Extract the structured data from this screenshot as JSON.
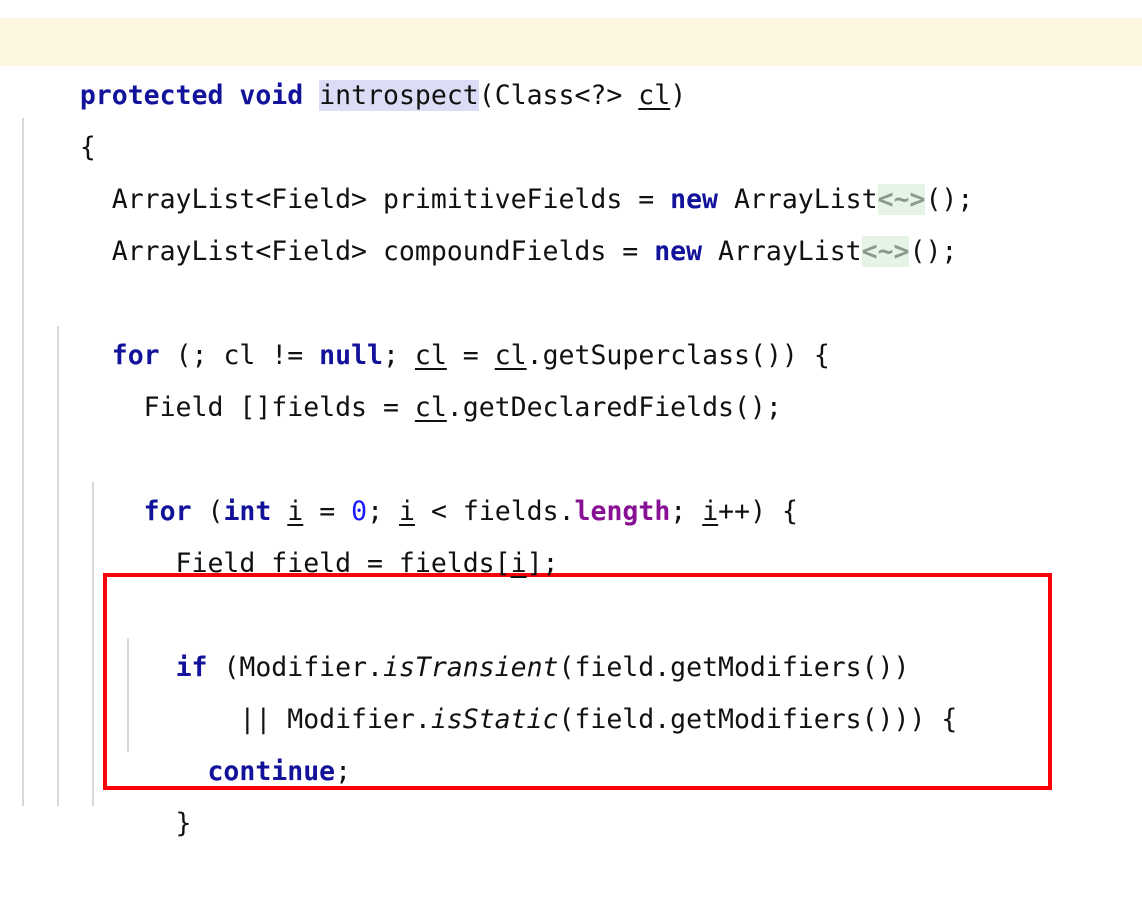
{
  "editor": {
    "language": "java",
    "background_color": "#ffffff",
    "caret_line_color": "#fdf7e2",
    "selection_color": "#dcdcf7",
    "folded_region_color": "#e6f4e6",
    "keyword_color": "#12129b",
    "number_color": "#1a1aff",
    "static_field_color": "#871094",
    "indent_guide_color": "#d7d7d7",
    "annotation_box_color": "#fb0007",
    "line_height_px": 52,
    "font_size_px": 26.5
  },
  "code": {
    "lines": [
      {
        "id": "line-signature",
        "text": "protected void introspect(Class<?> cl)",
        "caret_line": true
      },
      {
        "id": "line-open-brace",
        "text": "{"
      },
      {
        "id": "line-primitive-fields",
        "text": "  ArrayList<Field> primitiveFields = new ArrayList<~>();"
      },
      {
        "id": "line-compound-fields",
        "text": "  ArrayList<Field> compoundFields = new ArrayList<~>();"
      },
      {
        "id": "line-blank-1",
        "text": ""
      },
      {
        "id": "line-for-superclass",
        "text": "  for (; cl != null; cl = cl.getSuperclass()) {"
      },
      {
        "id": "line-declared-fields",
        "text": "    Field []fields = cl.getDeclaredFields();"
      },
      {
        "id": "line-blank-2",
        "text": ""
      },
      {
        "id": "line-for-fields",
        "text": "    for (int i = 0; i < fields.length; i++) {"
      },
      {
        "id": "line-field-assign",
        "text": "      Field field = fields[i];"
      },
      {
        "id": "line-blank-3",
        "text": ""
      },
      {
        "id": "line-if-transient",
        "text": "      if (Modifier.isTransient(field.getModifiers())"
      },
      {
        "id": "line-or-static",
        "text": "          || Modifier.isStatic(field.getModifiers())) {"
      },
      {
        "id": "line-continue",
        "text": "        continue;"
      },
      {
        "id": "line-close-brace",
        "text": "      }"
      }
    ],
    "folded_placeholder": "<~>",
    "highlighted_identifier": "introspect",
    "annotation_box_label": "red-highlight-box"
  }
}
